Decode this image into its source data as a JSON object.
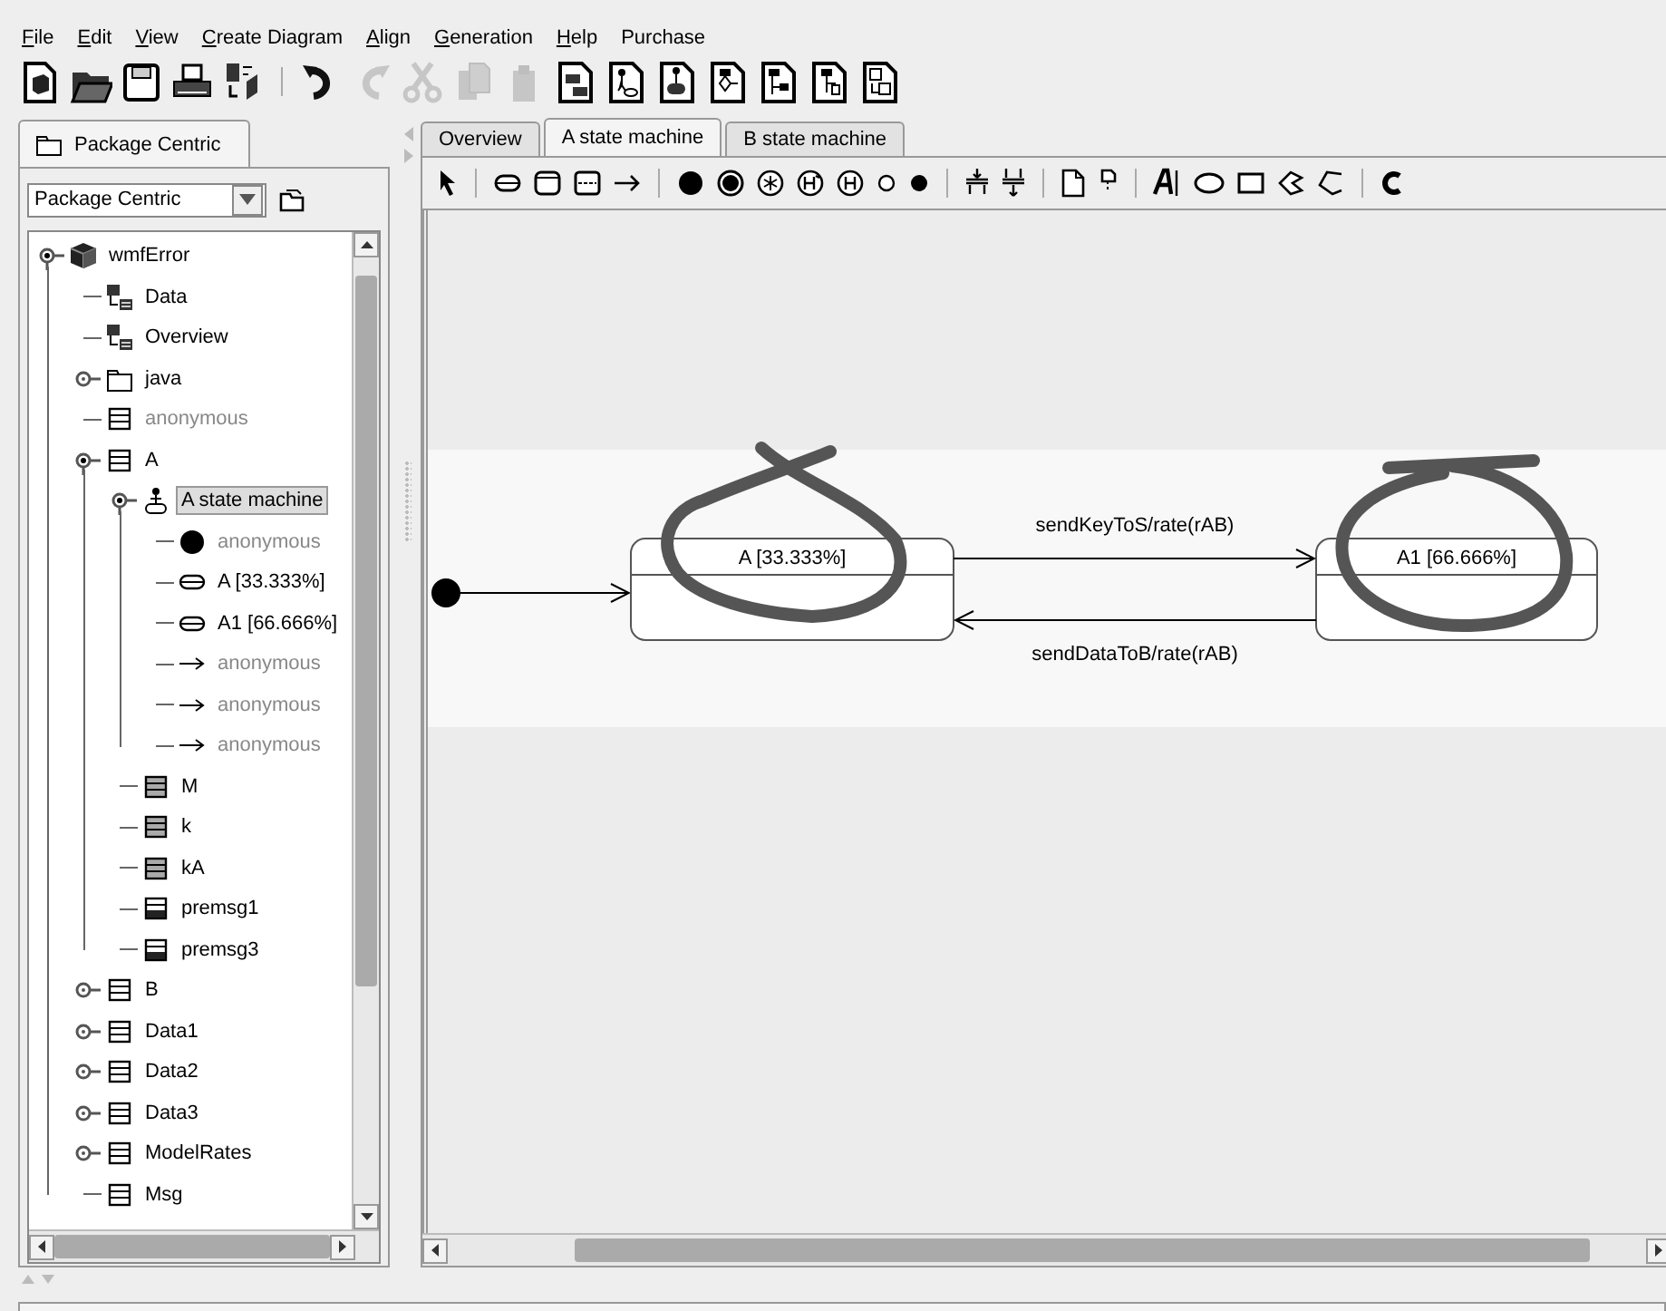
{
  "menu": [
    {
      "label": "File",
      "mnemonic": true
    },
    {
      "label": "Edit",
      "mnemonic": true
    },
    {
      "label": "View",
      "mnemonic": true
    },
    {
      "label": "Create Diagram",
      "mnemonic": true
    },
    {
      "label": "Align",
      "mnemonic": true
    },
    {
      "label": "Generation",
      "mnemonic": true
    },
    {
      "label": "Help",
      "mnemonic": true
    },
    {
      "label": "Purchase",
      "mnemonic": false
    }
  ],
  "toolbar": [
    {
      "disabled": false
    },
    {
      "disabled": false
    },
    {
      "disabled": false
    },
    {
      "disabled": false
    },
    {
      "disabled": false
    },
    {
      "disabled": false
    },
    {
      "disabled": true
    },
    {
      "disabled": true
    },
    {
      "disabled": true
    },
    {
      "disabled": true
    },
    {
      "disabled": false
    },
    {
      "disabled": false
    },
    {
      "disabled": false
    },
    {
      "disabled": false
    },
    {
      "disabled": false
    },
    {
      "disabled": false
    },
    {
      "disabled": false
    }
  ],
  "left_panel": {
    "tab": "Package Centric",
    "view_select": {
      "value": "Package Centric"
    },
    "tree": [
      {
        "label": "wmfError",
        "kind": "model",
        "expandable": true,
        "expanded": true,
        "dimmed": false,
        "selected": false,
        "children": [
          {
            "label": "Data",
            "kind": "diagram",
            "expandable": false,
            "dimmed": false,
            "selected": false
          },
          {
            "label": "Overview",
            "kind": "diagram",
            "expandable": false,
            "dimmed": false,
            "selected": false
          },
          {
            "label": "java",
            "kind": "package",
            "expandable": true,
            "expanded": false,
            "dimmed": false,
            "selected": false
          },
          {
            "label": "anonymous",
            "kind": "class",
            "expandable": false,
            "dimmed": true,
            "selected": false
          },
          {
            "label": "A",
            "kind": "class",
            "expandable": true,
            "expanded": true,
            "dimmed": false,
            "selected": false,
            "children": [
              {
                "label": "A state machine",
                "kind": "state-machine",
                "expandable": true,
                "expanded": true,
                "dimmed": false,
                "selected": true,
                "children": [
                  {
                    "label": "anonymous",
                    "kind": "initial",
                    "expandable": false,
                    "dimmed": true,
                    "selected": false
                  },
                  {
                    "label": "A [33.333%]",
                    "kind": "state",
                    "expandable": false,
                    "dimmed": false,
                    "selected": false
                  },
                  {
                    "label": "A1 [66.666%]",
                    "kind": "state",
                    "expandable": false,
                    "dimmed": false,
                    "selected": false
                  },
                  {
                    "label": "anonymous",
                    "kind": "transition",
                    "expandable": false,
                    "dimmed": true,
                    "selected": false
                  },
                  {
                    "label": "anonymous",
                    "kind": "transition",
                    "expandable": false,
                    "dimmed": true,
                    "selected": false
                  },
                  {
                    "label": "anonymous",
                    "kind": "transition",
                    "expandable": false,
                    "dimmed": true,
                    "selected": false
                  }
                ]
              },
              {
                "label": "M",
                "kind": "attribute",
                "expandable": false,
                "dimmed": false,
                "selected": false
              },
              {
                "label": "k",
                "kind": "attribute",
                "expandable": false,
                "dimmed": false,
                "selected": false
              },
              {
                "label": "kA",
                "kind": "attribute",
                "expandable": false,
                "dimmed": false,
                "selected": false
              },
              {
                "label": "premsg1",
                "kind": "message",
                "expandable": false,
                "dimmed": false,
                "selected": false
              },
              {
                "label": "premsg3",
                "kind": "message",
                "expandable": false,
                "dimmed": false,
                "selected": false
              }
            ]
          },
          {
            "label": "B",
            "kind": "class",
            "expandable": true,
            "expanded": false,
            "dimmed": false,
            "selected": false
          },
          {
            "label": "Data1",
            "kind": "class",
            "expandable": true,
            "expanded": false,
            "dimmed": false,
            "selected": false
          },
          {
            "label": "Data2",
            "kind": "class",
            "expandable": true,
            "expanded": false,
            "dimmed": false,
            "selected": false
          },
          {
            "label": "Data3",
            "kind": "class",
            "expandable": true,
            "expanded": false,
            "dimmed": false,
            "selected": false
          },
          {
            "label": "ModelRates",
            "kind": "class",
            "expandable": true,
            "expanded": false,
            "dimmed": false,
            "selected": false
          },
          {
            "label": "Msg",
            "kind": "class",
            "expandable": false,
            "dimmed": false,
            "selected": false
          }
        ]
      }
    ]
  },
  "editor": {
    "tabs": [
      {
        "label": "Overview",
        "selected": false
      },
      {
        "label": "A state machine",
        "selected": true
      },
      {
        "label": "B state machine",
        "selected": false
      }
    ],
    "diagram": {
      "states": [
        {
          "name": "A [33.333%]"
        },
        {
          "name": "A1 [66.666%]"
        }
      ],
      "transitions": [
        {
          "label": "sendKeyToS/rate(rAB)"
        },
        {
          "label": "sendDataToB/rate(rAB)"
        }
      ]
    }
  }
}
